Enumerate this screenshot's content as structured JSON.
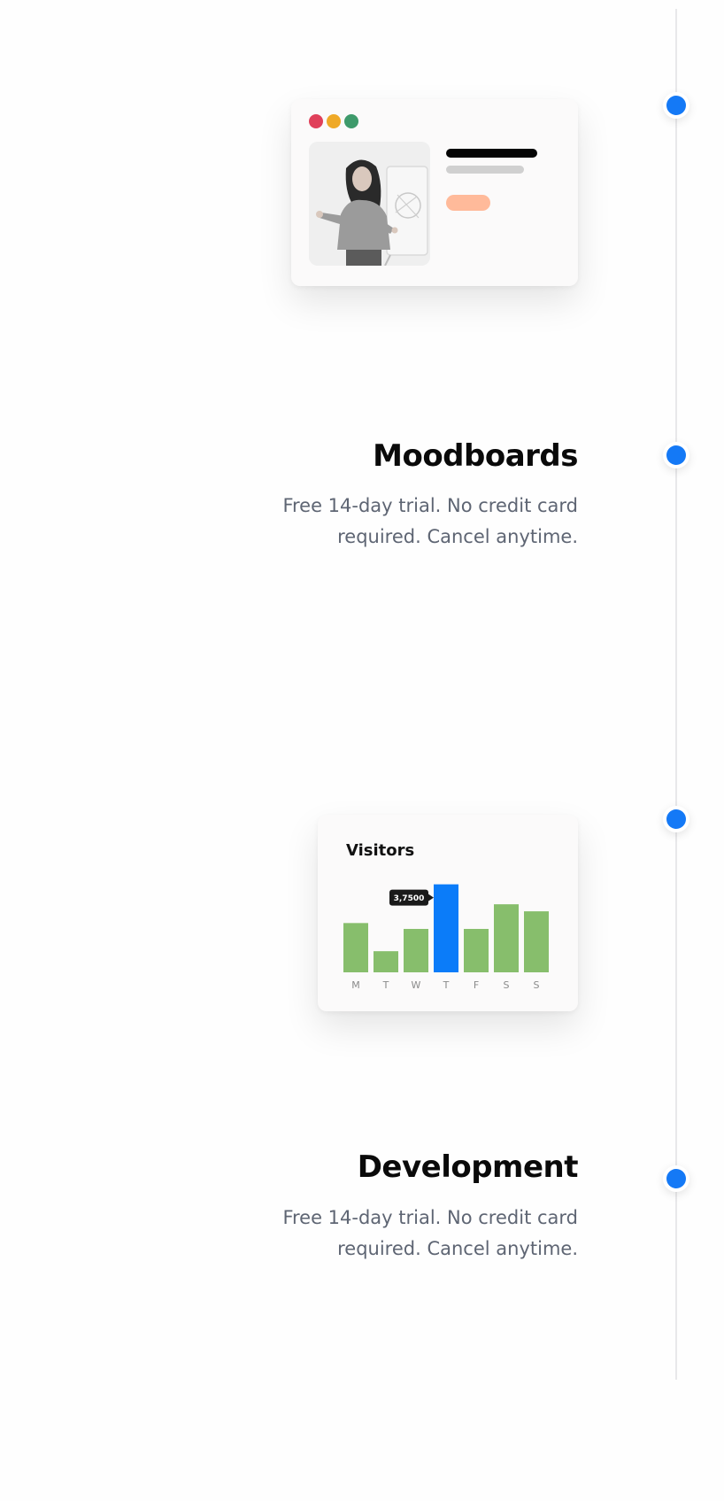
{
  "timeline": {
    "items": [
      {
        "type": "visual",
        "visual": "profile-card"
      },
      {
        "type": "text",
        "title": "Moodboards",
        "description": "Free 14-day trial. No credit card required. Cancel anytime."
      },
      {
        "type": "visual",
        "visual": "visitors-chart"
      },
      {
        "type": "text",
        "title": "Development",
        "description": "Free 14-day trial. No credit card required. Cancel anytime."
      }
    ],
    "accent_color": "#1479f6"
  },
  "profile_card": {
    "window_dots": [
      "#e0405a",
      "#efa927",
      "#3e9a6b"
    ],
    "button_color": "#ffba9a"
  },
  "chart_data": {
    "type": "bar",
    "title": "Visitors",
    "categories": [
      "M",
      "T",
      "W",
      "T",
      "F",
      "S",
      "S"
    ],
    "values": [
      2100,
      900,
      1850,
      3750,
      1850,
      2900,
      2600
    ],
    "highlight_index": 3,
    "tooltip": "3,7500",
    "ylim": [
      0,
      4000
    ],
    "bar_color": "#87be6c",
    "highlight_color": "#0b7cf9",
    "grid": false
  }
}
